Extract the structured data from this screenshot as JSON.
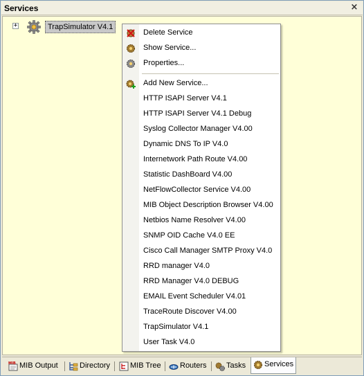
{
  "window": {
    "title": "Services",
    "close_glyph": "×"
  },
  "tree": {
    "expander_glyph": "+",
    "node_label": "TrapSimulator  V4.1",
    "node_icon": "gear-icon"
  },
  "context_menu": {
    "top_items": [
      {
        "label": "Delete Service",
        "icon": "gear-delete-icon"
      },
      {
        "label": "Show Service...",
        "icon": "gear-icon"
      },
      {
        "label": "Properties...",
        "icon": "gear-properties-icon"
      }
    ],
    "add_item": {
      "label": "Add New Service...",
      "icon": "gear-add-icon"
    },
    "service_items": [
      "HTTP ISAPI Server  V4.1",
      "HTTP ISAPI Server  V4.1 Debug",
      "Syslog Collector Manager  V4.00",
      "Dynamic DNS To IP  V4.0",
      "Internetwork Path Route V4.00",
      "Statistic DashBoard V4.00",
      "NetFlowCollector Service  V4.00",
      "MIB Object Description Browser V4.00",
      "Netbios Name Resolver V4.00",
      "SNMP OID Cache  V4.0 EE",
      "Cisco Call Manager SMTP Proxy  V4.0",
      "RRD manager  V4.0",
      "RRD Manager  V4.0 DEBUG",
      "EMAIL Event Scheduler V4.01",
      "TraceRoute Discover V4.00",
      "TrapSimulator  V4.1",
      "User Task  V4.0"
    ]
  },
  "tabs": [
    {
      "label": "MIB Output",
      "icon": "mib-icon",
      "active": false
    },
    {
      "label": "Directory",
      "icon": "directory-icon",
      "active": false
    },
    {
      "label": "MIB Tree",
      "icon": "mib-tree-icon",
      "active": false
    },
    {
      "label": "Routers",
      "icon": "routers-icon",
      "active": false
    },
    {
      "label": "Tasks",
      "icon": "tasks-icon",
      "active": false
    },
    {
      "label": "Services",
      "icon": "services-icon",
      "active": true
    }
  ],
  "colors": {
    "panel_bg": "#ffffd8",
    "menu_bg": "#ffffff",
    "selection_bg": "#c8c8c8"
  }
}
